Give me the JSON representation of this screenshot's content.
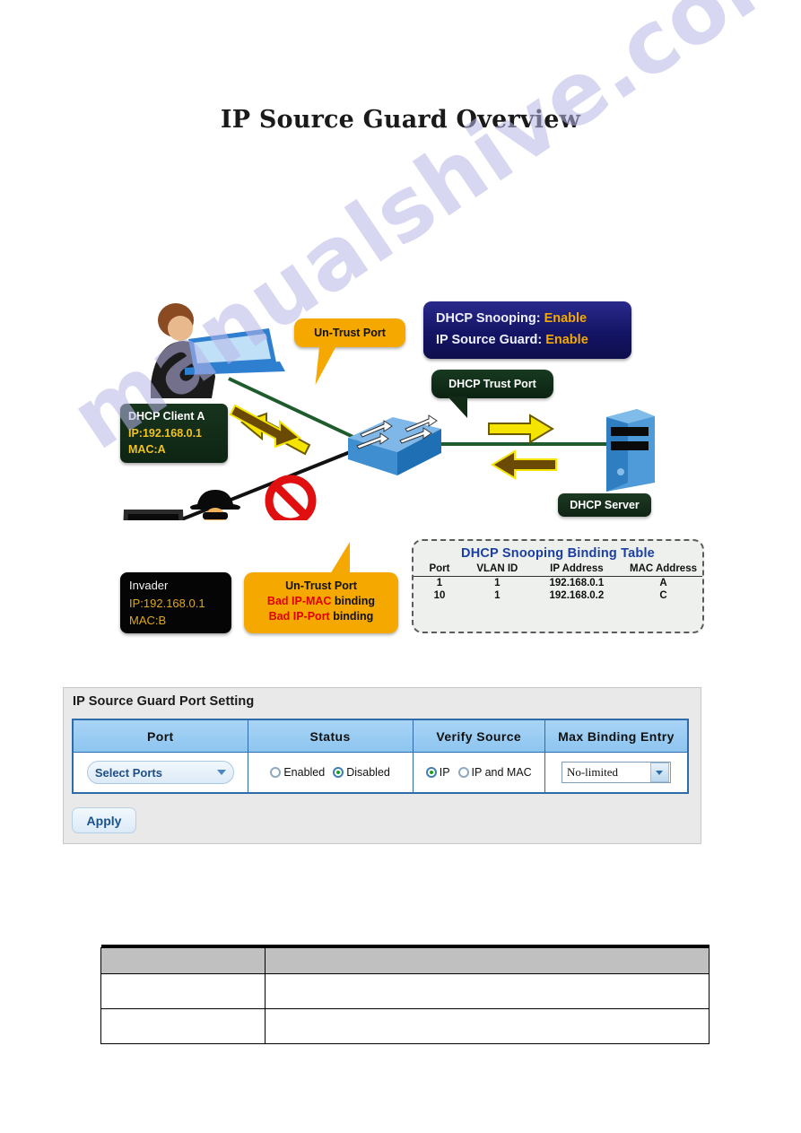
{
  "document": {
    "title": "IP Source Guard Overview",
    "watermark": "manualshive.com"
  },
  "diagram": {
    "config_box": {
      "row1_label": "DHCP Snooping:",
      "row1_value": "Enable",
      "row2_label": "IP Source Guard:",
      "row2_value": "Enable",
      "bg_color": "#141466",
      "value_color": "#f2a900"
    },
    "client_box": {
      "name": "DHCP Client A",
      "ip": "IP:192.168.0.1",
      "mac": "MAC:A",
      "bg_color": "#0e2414"
    },
    "invader_box": {
      "name": "Invader",
      "ip": "IP:192.168.0.1",
      "mac": "MAC:B",
      "bg_color": "#050505"
    },
    "callouts": {
      "untrust_top": "Un-Trust Port",
      "dhcp_trust": "DHCP Trust Port",
      "untrust_bottom_title": "Un-Trust Port",
      "untrust_bottom_line2_red": "Bad IP-MAC",
      "untrust_bottom_line2_rest": " binding",
      "untrust_bottom_line3_red": "Bad IP-Port",
      "untrust_bottom_line3_rest": " binding",
      "untrust_color": "#f5a800",
      "trust_color": "#122b17"
    },
    "server_label": "DHCP Server",
    "binding_table": {
      "title": "DHCP Snooping Binding Table",
      "columns": [
        "Port",
        "VLAN ID",
        "IP Address",
        "MAC Address"
      ],
      "rows": [
        [
          "1",
          "1",
          "192.168.0.1",
          "A"
        ],
        [
          "10",
          "1",
          "192.168.0.2",
          "C"
        ]
      ],
      "title_color": "#1b3fa0"
    }
  },
  "settings_panel": {
    "title": "IP Source Guard Port Setting",
    "columns": [
      "Port",
      "Status",
      "Verify Source",
      "Max Binding Entry"
    ],
    "port": {
      "dropdown_label": "Select Ports"
    },
    "status": {
      "options": [
        "Enabled",
        "Disabled"
      ],
      "selected": "Disabled"
    },
    "verify_source": {
      "options": [
        "IP",
        "IP and MAC"
      ],
      "selected": "IP"
    },
    "max_binding_entry": {
      "value": "No-limited"
    },
    "apply_label": "Apply"
  },
  "bottom_table": {
    "header": [
      "",
      ""
    ],
    "rows": [
      [
        "",
        ""
      ],
      [
        "",
        ""
      ]
    ]
  }
}
